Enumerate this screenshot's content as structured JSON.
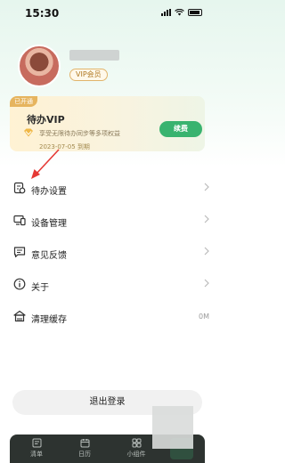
{
  "status_bar": {
    "time": "15:30"
  },
  "profile": {
    "username": "",
    "vip_tag": "VIP会员"
  },
  "vip_card": {
    "badge": "已开通",
    "title": "待办VIP",
    "description": "享受无限待办同步等多项权益",
    "expire": "2023-07-05 到期",
    "renew_button": "续费"
  },
  "menu": [
    {
      "label": "待办设置",
      "icon": "todo-settings-icon"
    },
    {
      "label": "设备管理",
      "icon": "device-icon"
    },
    {
      "label": "意见反馈",
      "icon": "feedback-icon"
    },
    {
      "label": "关于",
      "icon": "info-icon"
    },
    {
      "label": "清理缓存",
      "icon": "clean-icon",
      "value": "0M"
    }
  ],
  "logout_button": "退出登录",
  "tabbar": [
    {
      "label": "清单",
      "icon": "list-icon"
    },
    {
      "label": "日历",
      "icon": "calendar-icon"
    },
    {
      "label": "小组件",
      "icon": "widget-icon"
    }
  ],
  "colors": {
    "accent": "#39b36f",
    "vip_gold": "#e6b45e",
    "tabbar": "#2d3330",
    "annotation_arrow": "#e53935"
  }
}
